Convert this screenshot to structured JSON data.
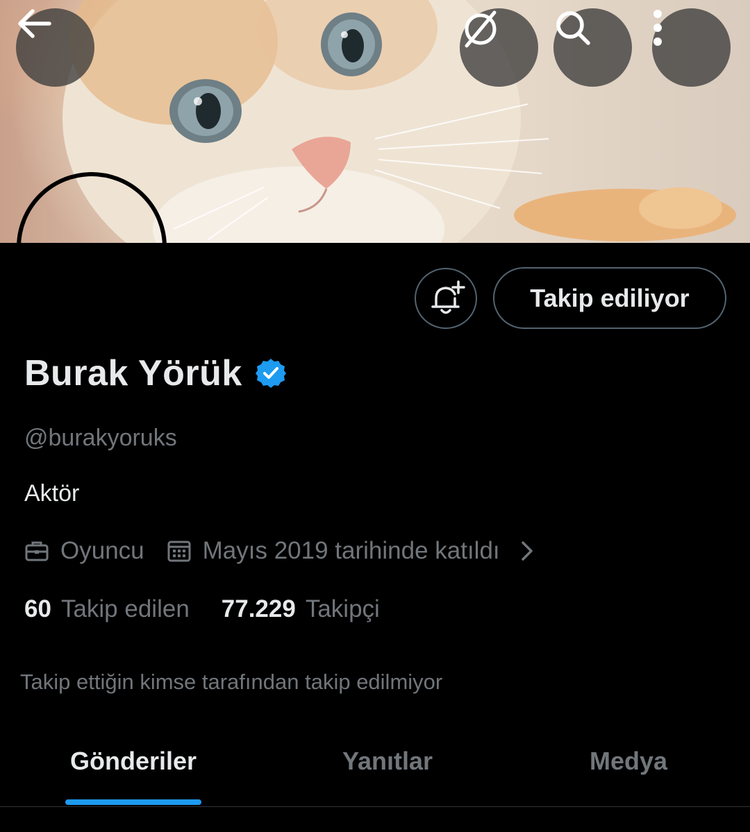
{
  "header": {
    "back_icon": "arrow-left-icon",
    "grok_icon": "grok-icon",
    "search_icon": "search-icon",
    "more_icon": "more-vertical-icon"
  },
  "profile": {
    "name": "Burak Yörük",
    "verified": true,
    "handle": "@burakyoruks",
    "bio": "Aktör",
    "profession": "Oyuncu",
    "joined": "Mayıs 2019 tarihinde katıldı",
    "following_count": "60",
    "following_label": "Takip edilen",
    "followers_count": "77.229",
    "followers_label": "Takipçi",
    "followed_by_note": "Takip ettiğin kimse tarafından takip edilmiyor"
  },
  "actions": {
    "notify_icon": "bell-plus-icon",
    "follow_label": "Takip ediliyor"
  },
  "tabs": [
    {
      "label": "Gönderiler",
      "active": true
    },
    {
      "label": "Yanıtlar",
      "active": false
    },
    {
      "label": "Medya",
      "active": false
    }
  ],
  "colors": {
    "accent": "#1d9bf0",
    "background": "#000000",
    "text_primary": "#e7e9ea",
    "text_secondary": "#71767b",
    "verified_badge": "#1d9bf0"
  }
}
